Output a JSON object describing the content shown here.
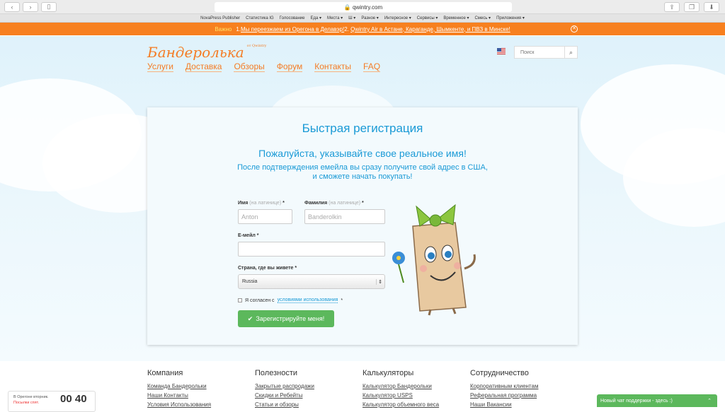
{
  "browser": {
    "url": "qwintry.com",
    "bookmarks": [
      "NovaPress Publisher",
      "Статистика IG",
      "Голосование",
      "Еда ▾",
      "Места ▾",
      "Ш ▾",
      "Разное ▾",
      "Интересное ▾",
      "Сервисы ▾",
      "Временное ▾",
      "Смесь ▾",
      "Приложения ▾"
    ]
  },
  "notice": {
    "label": "Важно",
    "text1": "1. ",
    "link1": "Мы переезжаем из Орегона в Делавэр!",
    "text2": " 2. ",
    "link2": "Qwintry Air в Астане, Караганде, Шымкенте, и ПВЗ в Минске!"
  },
  "header": {
    "logo": "Бандеролька",
    "logo_sub": "от Qwintry",
    "search_placeholder": "Поиск",
    "nav": [
      "Услуги",
      "Доставка",
      "Обзоры",
      "Форум",
      "Контакты",
      "FAQ"
    ]
  },
  "form": {
    "title": "Быстрая регистрация",
    "subtitle": "Пожалуйста, указывайте свое реальное имя!",
    "note1": "После подтверждения емейла вы сразу получите свой адрес в США,",
    "note2": "и сможете начать покупать!",
    "first_label": "Имя",
    "last_label": "Фамилия",
    "latin_hint": "(на латинице)",
    "req": "*",
    "first_placeholder": "Anton",
    "last_placeholder": "Banderolkin",
    "email_label": "E-мейл *",
    "country_label": "Страна, где вы живете *",
    "country_value": "Russia",
    "agree_text": "Я согласен с",
    "agree_link": "условиями использования",
    "submit": "Зарегистрируйте меня!"
  },
  "footer": [
    {
      "title": "Компания",
      "links": [
        "Команда Бандерольки",
        "Наши Контакты",
        "Условия Использования"
      ]
    },
    {
      "title": "Полезности",
      "links": [
        "Закрытые распродажи",
        "Скидки и Ребейты",
        "Статьи и обзоры"
      ]
    },
    {
      "title": "Калькуляторы",
      "links": [
        "Калькулятор Бандерольки",
        "Калькулятор USPS",
        "Калькулятор объемного веса"
      ]
    },
    {
      "title": "Сотрудничество",
      "links": [
        "Корпоративным клиентам",
        "Реферальная программа",
        "Наши Вакансии"
      ]
    }
  ],
  "clock": {
    "line1": "В Орегоне вторник.",
    "line2": "Посылки спят.",
    "time": "00 40"
  },
  "chat": {
    "label": "Новый чат поддержки - здесь :)"
  }
}
